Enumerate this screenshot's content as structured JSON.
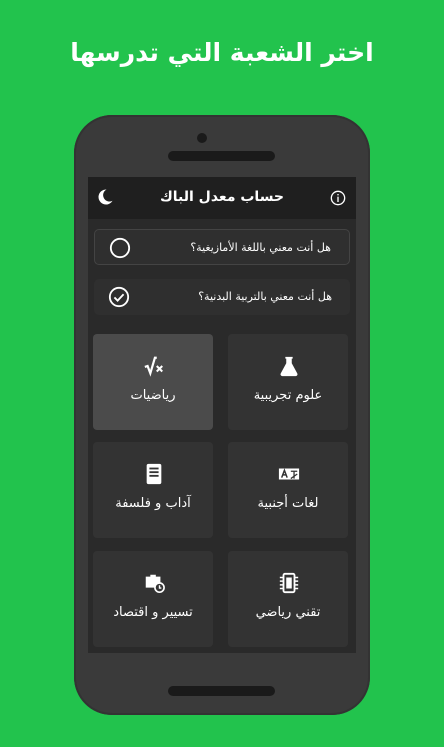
{
  "headline": "اختر الشعبة التي تدرسها",
  "app": {
    "title": "حساب معدل الباك",
    "moon_icon": "moon-icon",
    "info_icon": "info-icon"
  },
  "questions": [
    {
      "text": "هل أنت معني باللغة الأمازيغية؟",
      "checked": false
    },
    {
      "text": "هل أنت معني بالتربية البدنية؟",
      "checked": true
    }
  ],
  "branches": [
    {
      "label": "علوم تجريبية",
      "icon": "flask-icon",
      "selected": false
    },
    {
      "label": "رياضيات",
      "icon": "square-root-icon",
      "selected": true
    },
    {
      "label": "لغات أجنبية",
      "icon": "translate-icon",
      "selected": false
    },
    {
      "label": "آداب و فلسفة",
      "icon": "book-icon",
      "selected": false
    },
    {
      "label": "تقني رياضي",
      "icon": "chip-icon",
      "selected": false
    },
    {
      "label": "تسيير و اقتصاد",
      "icon": "briefcase-clock-icon",
      "selected": false
    }
  ],
  "colors": {
    "background": "#22c34d",
    "phone": "#3a3a3a",
    "screen": "#2a2a2a",
    "tile": "#333333",
    "tile_selected": "#4b4b4b"
  }
}
